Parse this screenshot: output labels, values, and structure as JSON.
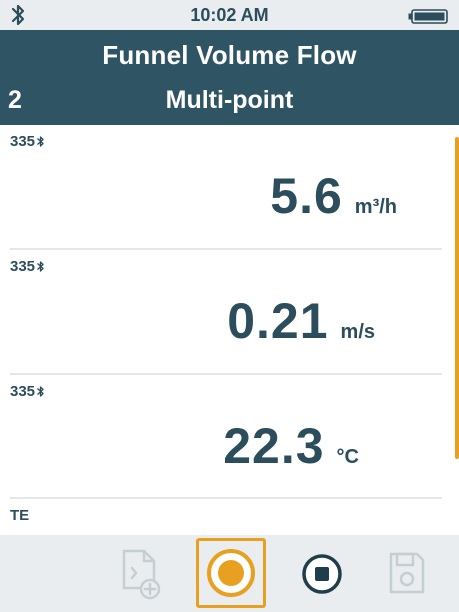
{
  "status_bar": {
    "time": "10:02 AM",
    "bluetooth_icon": "bluetooth-icon",
    "battery_icon": "battery-full-icon"
  },
  "header": {
    "title": "Funnel Volume Flow",
    "index": "2",
    "mode": "Multi-point",
    "background_color": "#2f5565"
  },
  "readings": [
    {
      "probe": "335",
      "probe_icon": "bluetooth-icon",
      "value": "5.6",
      "unit": "m³/h"
    },
    {
      "probe": "335",
      "probe_icon": "bluetooth-icon",
      "value": "0.21",
      "unit": "m/s"
    },
    {
      "probe": "335",
      "probe_icon": "bluetooth-icon",
      "value": "22.3",
      "unit": "°C"
    },
    {
      "probe": "TE"
    }
  ],
  "toolbar": {
    "buttons": [
      {
        "icon": "report-document-icon",
        "state": "disabled"
      },
      {
        "icon": "record-icon",
        "state": "active"
      },
      {
        "icon": "stop-icon",
        "state": "enabled"
      },
      {
        "icon": "save-icon",
        "state": "disabled"
      }
    ]
  },
  "colors": {
    "accent": "#e8a020",
    "text": "#2c4d5c",
    "bar_background": "#e9edef"
  }
}
